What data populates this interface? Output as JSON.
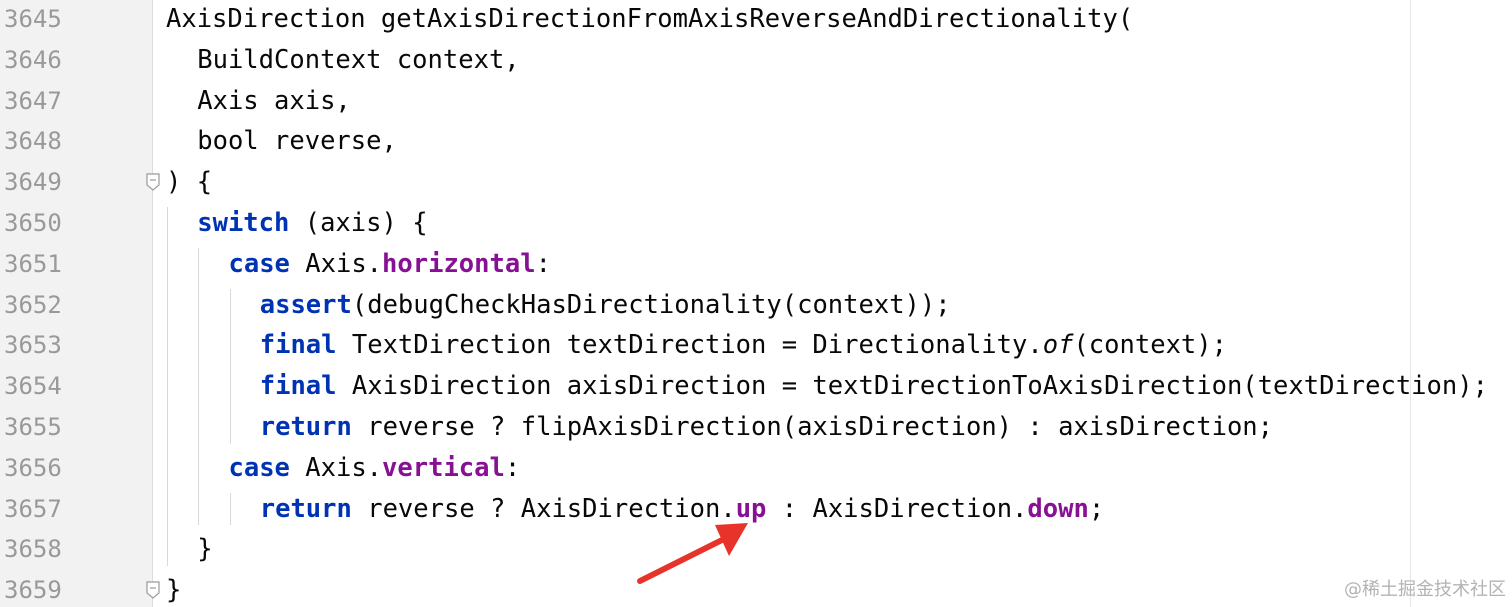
{
  "editor": {
    "line_numbers": [
      "3645",
      "3646",
      "3647",
      "3648",
      "3649",
      "3650",
      "3651",
      "3652",
      "3653",
      "3654",
      "3655",
      "3656",
      "3657",
      "3658",
      "3659"
    ],
    "lines": [
      [
        {
          "t": "AxisDirection getAxisDirectionFromAxisReverseAndDirectionality(",
          "c": "plain"
        }
      ],
      [
        {
          "t": "BuildContext context,",
          "c": "plain"
        }
      ],
      [
        {
          "t": "Axis axis,",
          "c": "plain"
        }
      ],
      [
        {
          "t": "bool reverse,",
          "c": "plain"
        }
      ],
      [
        {
          "t": ") {",
          "c": "plain"
        }
      ],
      [
        {
          "t": "switch",
          "c": "kw"
        },
        {
          "t": " (axis) {",
          "c": "plain"
        }
      ],
      [
        {
          "t": "case",
          "c": "kw"
        },
        {
          "t": " Axis.",
          "c": "plain"
        },
        {
          "t": "horizontal",
          "c": "field"
        },
        {
          "t": ":",
          "c": "plain"
        }
      ],
      [
        {
          "t": "assert",
          "c": "kw"
        },
        {
          "t": "(debugCheckHasDirectionality(context));",
          "c": "plain"
        }
      ],
      [
        {
          "t": "final",
          "c": "kw"
        },
        {
          "t": " TextDirection textDirection = Directionality.",
          "c": "plain"
        },
        {
          "t": "of",
          "c": "italic"
        },
        {
          "t": "(context);",
          "c": "plain"
        }
      ],
      [
        {
          "t": "final",
          "c": "kw"
        },
        {
          "t": " AxisDirection axisDirection = textDirectionToAxisDirection(textDirection);",
          "c": "plain"
        }
      ],
      [
        {
          "t": "return",
          "c": "kw"
        },
        {
          "t": " reverse ? flipAxisDirection(axisDirection) : axisDirection;",
          "c": "plain"
        }
      ],
      [
        {
          "t": "case",
          "c": "kw"
        },
        {
          "t": " Axis.",
          "c": "plain"
        },
        {
          "t": "vertical",
          "c": "field"
        },
        {
          "t": ":",
          "c": "plain"
        }
      ],
      [
        {
          "t": "return",
          "c": "kw"
        },
        {
          "t": " reverse ? AxisDirection.",
          "c": "plain"
        },
        {
          "t": "up",
          "c": "field"
        },
        {
          "t": " : AxisDirection.",
          "c": "plain"
        },
        {
          "t": "down",
          "c": "field"
        },
        {
          "t": ";",
          "c": "plain"
        }
      ],
      [
        {
          "t": "}",
          "c": "plain"
        }
      ],
      [
        {
          "t": "}",
          "c": "plain"
        }
      ]
    ],
    "indent_levels": [
      0,
      1,
      1,
      1,
      0,
      1,
      2,
      3,
      3,
      3,
      3,
      2,
      3,
      1,
      0
    ],
    "fold_marker_lines": [
      "3649",
      "3659"
    ]
  },
  "annotation": {
    "arrow_color": "#e8332b"
  },
  "watermark": {
    "text": "@稀土掘金技术社区"
  },
  "colors": {
    "keyword": "#0033b3",
    "field": "#871094",
    "text": "#080808",
    "line_number": "#999999",
    "gutter_bg": "#f2f2f2"
  }
}
